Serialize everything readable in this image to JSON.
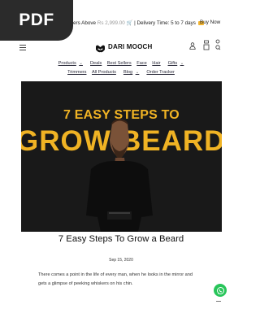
{
  "pdf_badge": "PDF",
  "announcement": {
    "text_before": "ers Above ",
    "price": "Rs 2,999.00",
    "text_after": " | Delivery Time: 5 to 7 days",
    "buy_now": "Buy Now"
  },
  "header": {
    "logo_text": "DARI MOOCH",
    "icons": [
      "menu-icon",
      "user-icon",
      "cart-icon",
      "search-icon"
    ]
  },
  "nav": {
    "row1": [
      "Products",
      "Deals",
      "Best Sellers",
      "Face",
      "Hair",
      "Gifts"
    ],
    "row2": [
      "Trimmers",
      "All Products",
      "Blog",
      "Order Tracker"
    ]
  },
  "hero": {
    "line1": "7 EASY STEPS TO",
    "line2_left": "GROW",
    "line2_right": "BEARD",
    "accent_color": "#f0b324",
    "background_color": "#191919"
  },
  "article": {
    "title": "7 Easy Steps To Grow a Beard",
    "date": "Sep 15, 2020",
    "excerpt_line1": "There comes a point in the life of every man, when he looks in the mirror and",
    "excerpt_line2": "gets a glimpse of peeking whiskers on his chin."
  },
  "floating": {
    "icon": "whatsapp-icon",
    "color": "#28c55a"
  }
}
